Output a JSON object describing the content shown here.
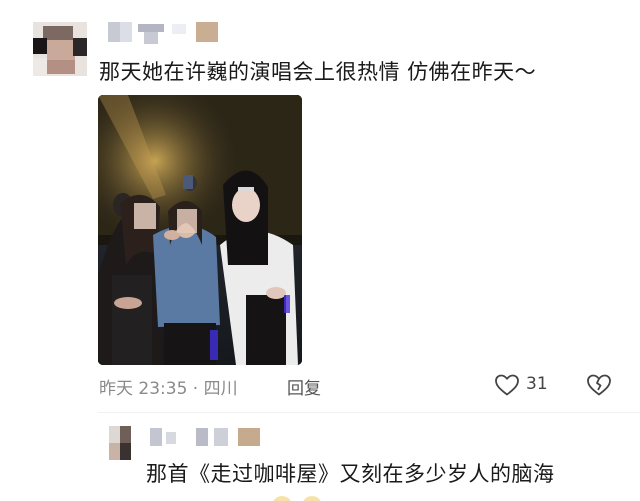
{
  "comments": [
    {
      "text": "那天她在许巍的演唱会上很热情 仿佛在昨天～",
      "time": "昨天 23:35 · 四川",
      "reply_label": "回复",
      "like_count": "31",
      "icons": {
        "like": "heart-outline-icon",
        "dislike": "broken-heart-icon"
      }
    },
    {
      "text": "那首《走过咖啡屋》又刻在多少岁人的脑海"
    }
  ],
  "colors": {
    "text": "#1a1a1a",
    "meta": "#8a8a8a",
    "icon": "#444444"
  }
}
